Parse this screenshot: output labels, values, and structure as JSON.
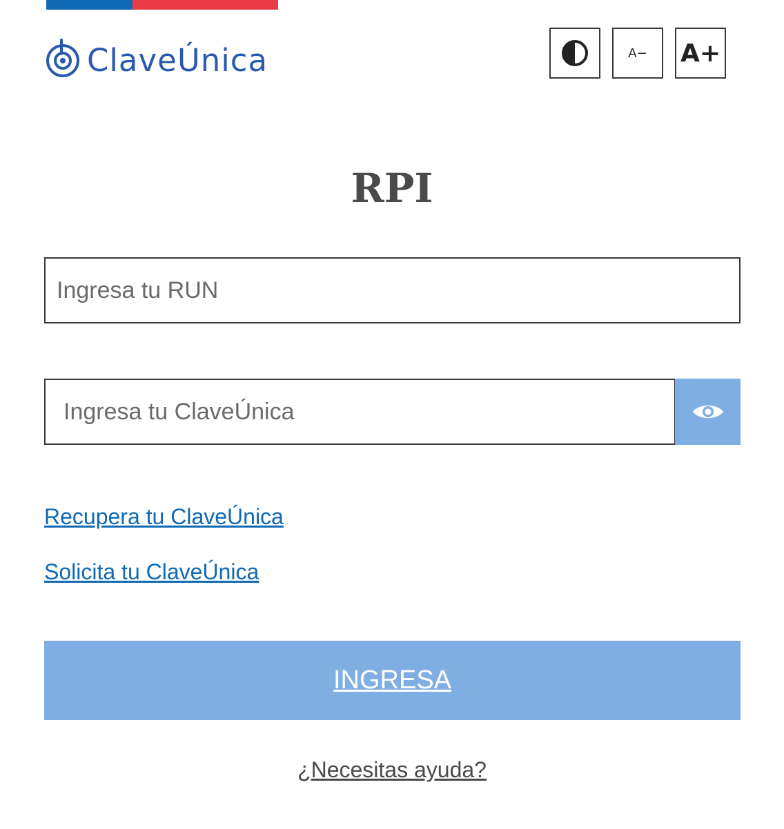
{
  "header": {
    "logo_text": "ClaveÚnica",
    "flag_colors": {
      "blue": "#0f69b4",
      "red": "#eb3c46"
    },
    "brand_color": "#2a5ab0",
    "accessibility": {
      "contrast_icon": "contrast-icon",
      "decrease_label": "A−",
      "increase_label": "A+"
    }
  },
  "main": {
    "title": "RPI",
    "run_input": {
      "placeholder": "Ingresa tu RUN",
      "value": ""
    },
    "password_input": {
      "placeholder": "Ingresa tu ClaveÚnica",
      "value": ""
    },
    "toggle_visibility_icon": "eye-icon",
    "links": {
      "recover": "Recupera tu ClaveÚnica",
      "request": "Solicita tu ClaveÚnica"
    },
    "submit_label": "INGRESA",
    "help_label": "¿Necesitas ayuda?"
  },
  "colors": {
    "link": "#0f69b4",
    "button_bg": "#7faee3",
    "title": "#4a4a4a"
  }
}
